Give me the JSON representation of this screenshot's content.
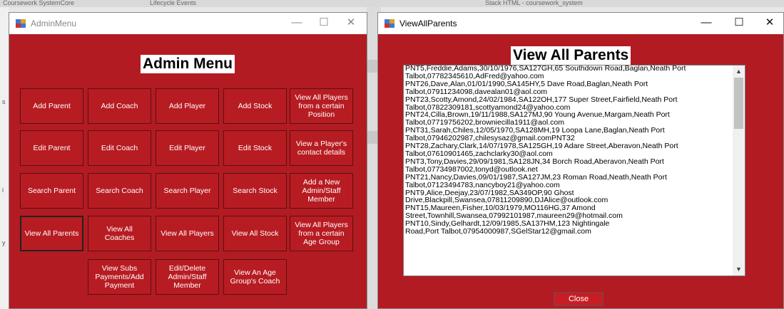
{
  "background": {
    "tab_titles": [
      "Coursework SystemCore",
      "Lifecycle Events",
      "Stack HTML - coursework_system"
    ],
    "side_letters": [
      "s",
      "i",
      "y"
    ]
  },
  "admin_window": {
    "title": "AdminMenu",
    "heading": "Admin Menu",
    "controls": {
      "minimize": "—",
      "maximize": "☐",
      "close": "✕"
    },
    "buttons": [
      "Add Parent",
      "Add Coach",
      "Add Player",
      "Add Stock",
      "View All Players\nfrom a certain\nPosition",
      "Edit Parent",
      "Edit Coach",
      "Edit Player",
      "Edit Stock",
      "View a Player's\ncontact details",
      "Search Parent",
      "Search Coach",
      "Search Player",
      "Search Stock",
      "Add a New\nAdmin/Staff\nMember",
      "View All Parents",
      "View All\nCoaches",
      "View All Players",
      "View All Stock",
      "View All Players\nfrom a certain\nAge Group",
      "View Subs\nPayments/Add\nPayment",
      "Edit/Delete\nAdmin/Staff\nMember",
      "View An Age\nGroup's Coach"
    ]
  },
  "parents_window": {
    "title": "ViewAllParents",
    "heading": "View All Parents",
    "controls": {
      "minimize": "—",
      "maximize": "☐",
      "close": "✕"
    },
    "list_text": "PNT5,Freddie,Adams,30/10/1976,SA127GH,65 Southdown Road,Baglan,Neath Port\nTalbot,07782345610,AdFred@yahoo.com\nPNT26,Dave,Alan,01/01/1990,SA145HY,5 Dave Road,Baglan,Neath Port\nTalbot,07911234098,davealan01@aol.com\nPNT23,Scotty,Amond,24/02/1984,SA122OH,177 Super Street,Fairfield,Neath Port\nTalbot,07822309181,scottyamond24@yahoo.com\nPNT24,Cilla,Brown,19/11/1988,SA127MJ,90 Young Avenue,Margam,Neath Port\nTalbot,07719756202,browniecilla1911@aol.com\nPNT31,Sarah,Chiles,12/05/1970,SA128MH,19 Loopa Lane,Baglan,Neath Port\nTalbot,07946202987,chilesysaz@gmail.comPNT32\nPNT28,Zachary,Clark,14/07/1978,SA125GH,19 Adare Street,Aberavon,Neath Port\nTalbot,07610901465,zachclarky30@aol.com\nPNT3,Tony,Davies,29/09/1981,SA128JN,34 Borch Road,Aberavon,Neath Port\nTalbot,07734987002,tonyd@outlook.net\nPNT21,Nancy,Davies,09/01/1987,SA127JM,23 Roman Road,Neath,Neath Port\nTalbot,07123494783,nancyboy21@yahoo.com\nPNT9,Alice,Deejay,23/07/1982,SA349OP,90 Ghost\nDrive,Blackpill,Swansea,07811209890,DJAlice@outlook.com\nPNT15,Maureen,Fisher,10/03/1979,MO116HG,37 Amond\nStreet,Townhill,Swansea,07992101987,maureen29@hotmail.com\nPNT10,Sindy,Gelhardt,12/09/1985,SA137HM,123 Nightingale\nRoad,Port Talbot,07954000987,SGelStar12@gmail.com",
    "scroll_up": "▲",
    "scroll_down": "▼",
    "close_label": "Close"
  },
  "colors": {
    "form_background": "#b21b22",
    "button_face": "#b71c22",
    "text_light": "#ffffff"
  }
}
